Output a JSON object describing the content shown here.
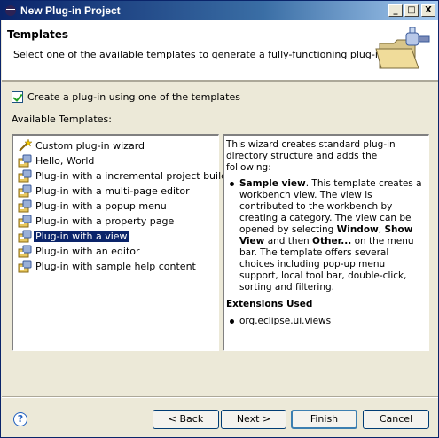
{
  "window": {
    "title": "New Plug-in Project",
    "controls": {
      "minimize": "_",
      "maximize": "□",
      "close": "X"
    }
  },
  "header": {
    "title": "Templates",
    "description": "Select one of the available templates to generate a fully-functioning plug-in."
  },
  "checkbox": {
    "label": "Create a plug-in using one of the templates",
    "checked": true
  },
  "templates": {
    "label": "Available Templates:",
    "items": [
      {
        "label": "Custom plug-in wizard"
      },
      {
        "label": "Hello, World"
      },
      {
        "label": "Plug-in with a incremental project builder"
      },
      {
        "label": "Plug-in with a multi-page editor"
      },
      {
        "label": "Plug-in with a popup menu"
      },
      {
        "label": "Plug-in with a property page"
      },
      {
        "label": "Plug-in with a view"
      },
      {
        "label": "Plug-in with an editor"
      },
      {
        "label": "Plug-in with sample help content"
      }
    ],
    "selected_index": 6
  },
  "description": {
    "intro": "This wizard creates standard plug-in directory structure and adds the following:",
    "bullet_title": "Sample view",
    "bullet_text_1": ". This template creates a workbench view. The view is contributed to the workbench by creating a category. The view can be opened by selecting ",
    "bullet_window": "Window",
    "bullet_sep1": ", ",
    "bullet_show_view": "Show View",
    "bullet_text_2": " and then ",
    "bullet_other": "Other...",
    "bullet_text_3": " on the menu bar. The template offers several choices including pop-up menu support, local tool bar, double-click, sorting and filtering.",
    "extensions_heading": "Extensions Used",
    "extension": "org.eclipse.ui.views"
  },
  "buttons": {
    "help": "?",
    "back": "< Back",
    "next": "Next >",
    "finish": "Finish",
    "cancel": "Cancel"
  },
  "colors": {
    "selection": "#0a246a",
    "titlebar": "#0a246a",
    "dialog_bg": "#ece9d8"
  },
  "icons": {
    "list_item": "plugin-template-icon",
    "header": "plugin-folder-icon"
  }
}
